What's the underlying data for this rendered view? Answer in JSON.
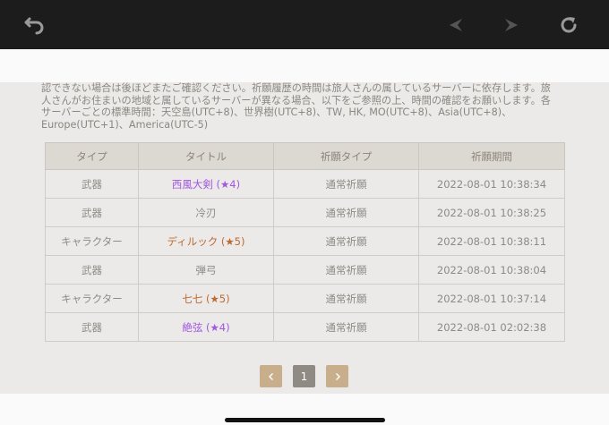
{
  "browser": {
    "icons": [
      "back-arrow-icon",
      "prev-arrow-icon",
      "next-arrow-icon",
      "reload-icon"
    ]
  },
  "intro_lines": [
    "認できない場合は後ほどまたご確認ください。祈願履歴の時間は旅人さんの属しているサーバーに依存します。旅",
    "人さんがお住まいの地域と属しているサーバーが異なる場合、以下をご参照の上、時間の確認をお願いします。各",
    "サーバーごとの標準時間：天空島(UTC+8)、世界樹(UTC+8)、TW, HK, MO(UTC+8)、Asia(UTC+8)、",
    "Europe(UTC+1)、America(UTC-5)"
  ],
  "table": {
    "headers": [
      "タイプ",
      "タイトル",
      "祈願タイプ",
      "祈願期間"
    ],
    "rows": [
      {
        "type": "武器",
        "title": "西風大剣 (★4)",
        "rarity": 4,
        "wish_type": "通常祈願",
        "time": "2022-08-01 10:38:34"
      },
      {
        "type": "武器",
        "title": "冷刃",
        "rarity": 3,
        "wish_type": "通常祈願",
        "time": "2022-08-01 10:38:25"
      },
      {
        "type": "キャラクター",
        "title": "ディルック (★5)",
        "rarity": 5,
        "wish_type": "通常祈願",
        "time": "2022-08-01 10:38:11"
      },
      {
        "type": "武器",
        "title": "弾弓",
        "rarity": 3,
        "wish_type": "通常祈願",
        "time": "2022-08-01 10:38:04"
      },
      {
        "type": "キャラクター",
        "title": "七七 (★5)",
        "rarity": 5,
        "wish_type": "通常祈願",
        "time": "2022-08-01 10:37:14"
      },
      {
        "type": "武器",
        "title": "絶弦 (★4)",
        "rarity": 4,
        "wish_type": "通常祈願",
        "time": "2022-08-01 02:02:38"
      }
    ]
  },
  "pagination": {
    "current_page": "1",
    "prev_icon": "chevron-left-icon",
    "next_icon": "chevron-right-icon"
  },
  "colors": {
    "rarity4": "#a256e1",
    "rarity5": "#bd6932",
    "rarity3": "#8e8a85",
    "nav_button": "#c8ae8a"
  }
}
